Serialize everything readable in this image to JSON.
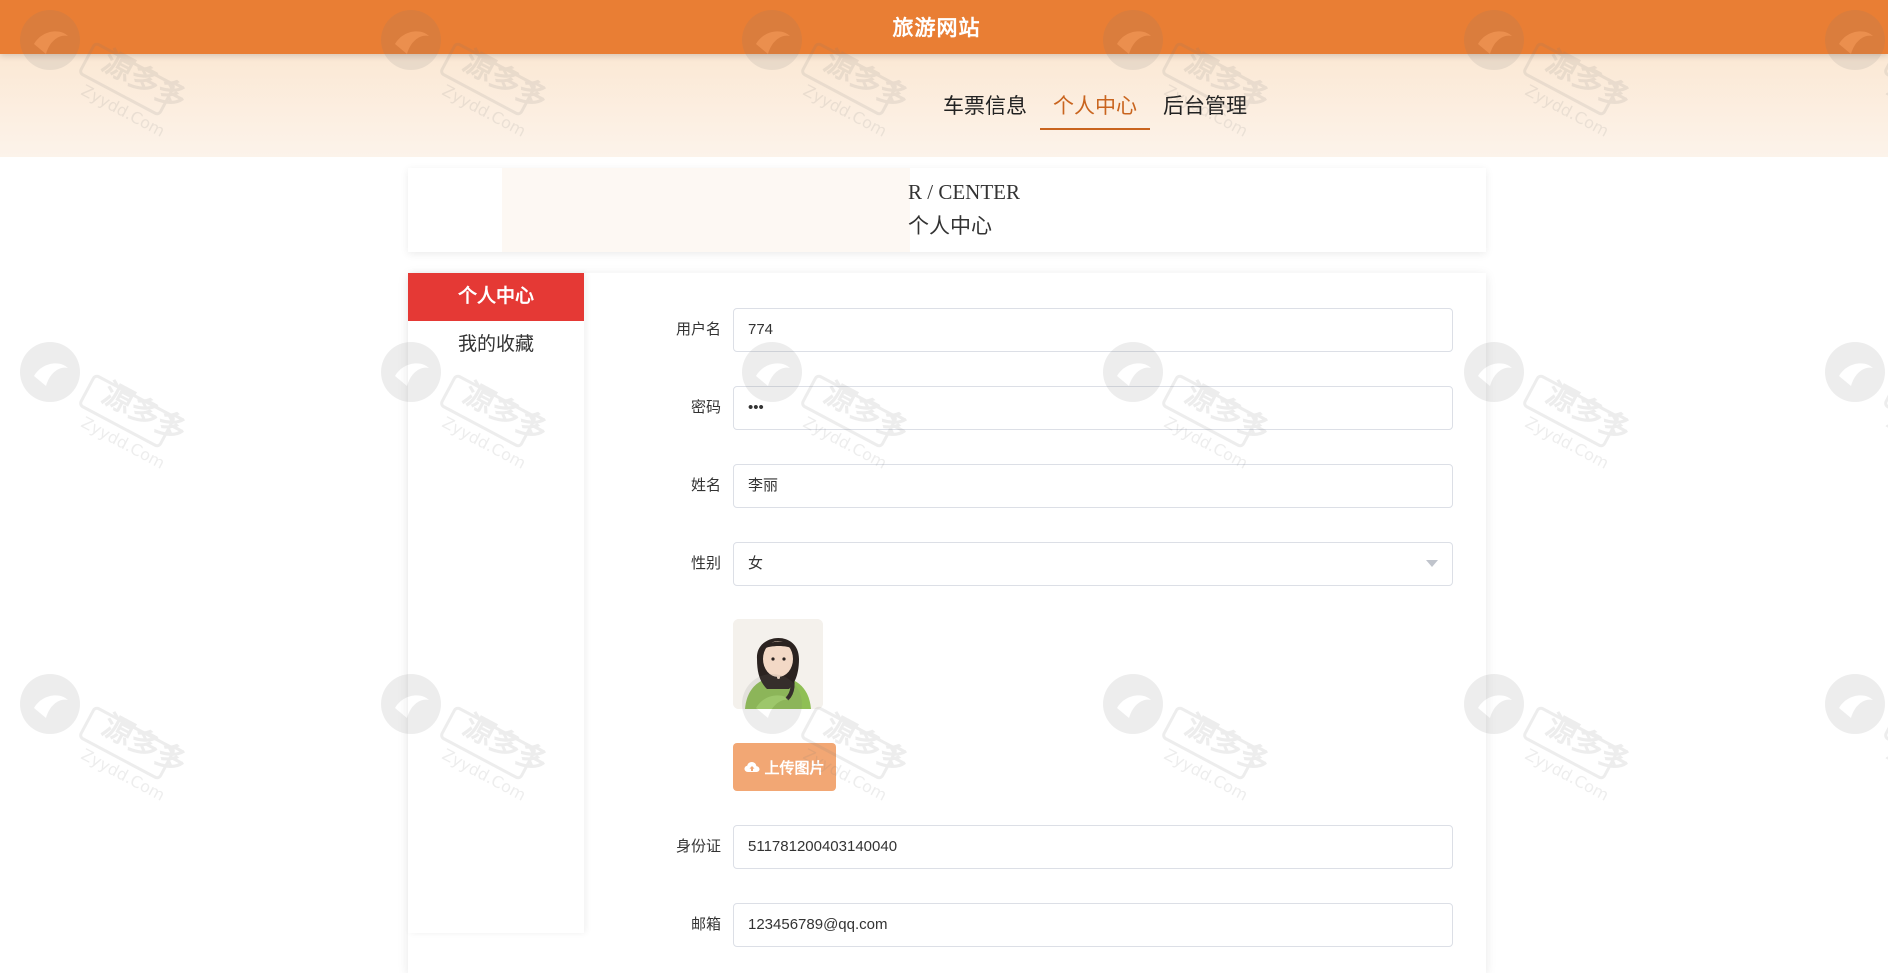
{
  "site": {
    "title": "旅游网站"
  },
  "nav": {
    "items": [
      {
        "label": "车票信息",
        "active": false
      },
      {
        "label": "个人中心",
        "active": true
      },
      {
        "label": "后台管理",
        "active": false
      }
    ]
  },
  "page_header": {
    "en_title": "R / CENTER",
    "cn_title": "个人中心"
  },
  "sidebar": {
    "items": [
      {
        "label": "个人中心",
        "active": true
      },
      {
        "label": "我的收藏",
        "active": false
      }
    ]
  },
  "form": {
    "username": {
      "label": "用户名",
      "value": "774"
    },
    "password": {
      "label": "密码",
      "value": "•••"
    },
    "name": {
      "label": "姓名",
      "value": "李丽"
    },
    "gender": {
      "label": "性别",
      "value": "女"
    },
    "upload_label": "上传图片",
    "id_card": {
      "label": "身份证",
      "value": "511781200403140040"
    },
    "email": {
      "label": "邮箱",
      "value": "123456789@qq.com"
    }
  },
  "watermark": {
    "brand_cn": "源多多",
    "brand_en": "Zyydd.Com"
  },
  "colors": {
    "topbar": "#e97e34",
    "accent": "#c9641e",
    "sidebar_active": "#e53935",
    "upload_button": "#f2a774"
  },
  "icons": {
    "upload": "cloud-upload-icon",
    "select_arrow": "chevron-down-icon"
  }
}
